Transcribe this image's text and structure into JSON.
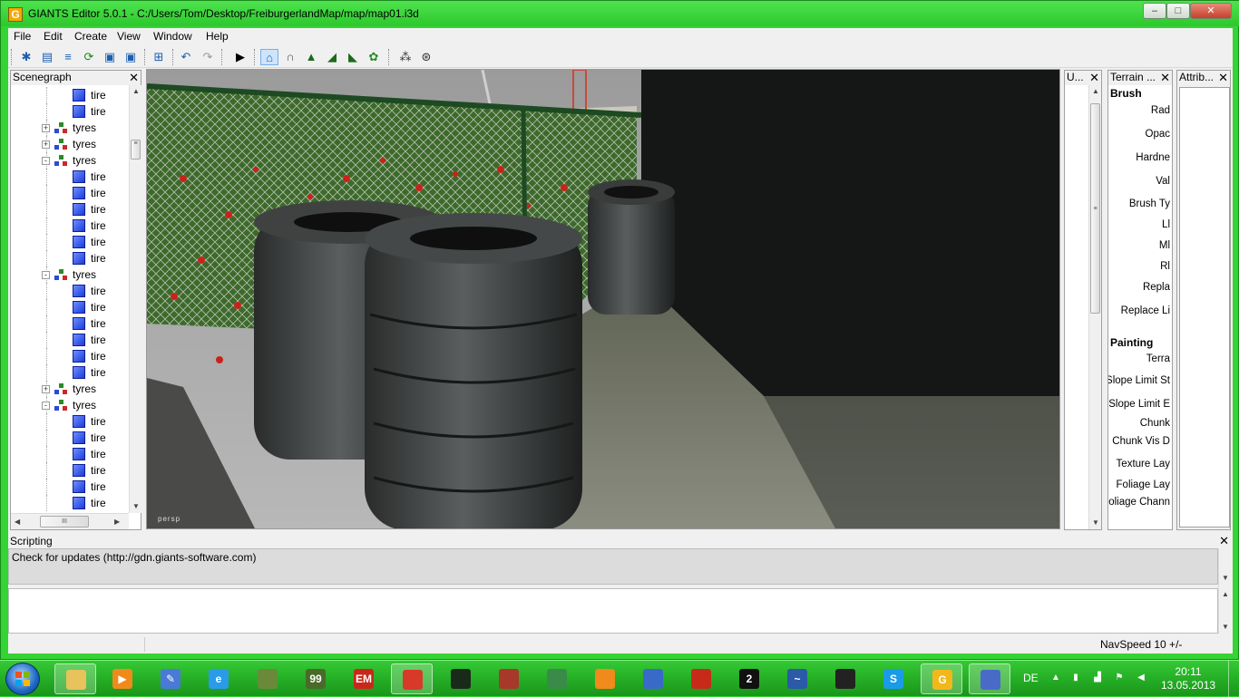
{
  "window": {
    "title": "GIANTS Editor 5.0.1 - C:/Users/Tom/Desktop/FreiburgerlandMap/map/map01.i3d",
    "app_icon_glyph": "G",
    "min_glyph": "–",
    "max_glyph": "□",
    "close_glyph": "✕"
  },
  "menu": {
    "file": "File",
    "edit": "Edit",
    "create": "Create",
    "view": "View",
    "window": "Window",
    "help": "Help"
  },
  "toolbar": {
    "icons": [
      "new-scene-icon",
      "open-icon",
      "recent-icon",
      "reload-icon",
      "save-icon",
      "save-as-icon",
      "import-icon",
      "undo-icon",
      "redo-icon",
      "play-icon",
      "select-home-icon",
      "magnet-icon",
      "terrain-sculpt-icon",
      "terrain-paint-icon",
      "terrain-foliage-icon",
      "foliage-paint-icon",
      "particle-icon",
      "particle-emitter-icon"
    ]
  },
  "scenegraph": {
    "title": "Scenegraph",
    "close": "✕",
    "rows": [
      {
        "label": "tire",
        "type": "shape",
        "level": 2,
        "expander": ""
      },
      {
        "label": "tire",
        "type": "shape",
        "level": 2,
        "expander": ""
      },
      {
        "label": "tyres",
        "type": "group",
        "level": 1,
        "expander": "+"
      },
      {
        "label": "tyres",
        "type": "group",
        "level": 1,
        "expander": "+"
      },
      {
        "label": "tyres",
        "type": "group",
        "level": 1,
        "expander": "-"
      },
      {
        "label": "tire",
        "type": "shape",
        "level": 2,
        "expander": ""
      },
      {
        "label": "tire",
        "type": "shape",
        "level": 2,
        "expander": ""
      },
      {
        "label": "tire",
        "type": "shape",
        "level": 2,
        "expander": ""
      },
      {
        "label": "tire",
        "type": "shape",
        "level": 2,
        "expander": ""
      },
      {
        "label": "tire",
        "type": "shape",
        "level": 2,
        "expander": ""
      },
      {
        "label": "tire",
        "type": "shape",
        "level": 2,
        "expander": ""
      },
      {
        "label": "tyres",
        "type": "group",
        "level": 1,
        "expander": "-"
      },
      {
        "label": "tire",
        "type": "shape",
        "level": 2,
        "expander": ""
      },
      {
        "label": "tire",
        "type": "shape",
        "level": 2,
        "expander": ""
      },
      {
        "label": "tire",
        "type": "shape",
        "level": 2,
        "expander": ""
      },
      {
        "label": "tire",
        "type": "shape",
        "level": 2,
        "expander": ""
      },
      {
        "label": "tire",
        "type": "shape",
        "level": 2,
        "expander": ""
      },
      {
        "label": "tire",
        "type": "shape",
        "level": 2,
        "expander": ""
      },
      {
        "label": "tyres",
        "type": "group",
        "level": 1,
        "expander": "+"
      },
      {
        "label": "tyres",
        "type": "group",
        "level": 1,
        "expander": "-"
      },
      {
        "label": "tire",
        "type": "shape",
        "level": 2,
        "expander": ""
      },
      {
        "label": "tire",
        "type": "shape",
        "level": 2,
        "expander": ""
      },
      {
        "label": "tire",
        "type": "shape",
        "level": 2,
        "expander": ""
      },
      {
        "label": "tire",
        "type": "shape",
        "level": 2,
        "expander": ""
      },
      {
        "label": "tire",
        "type": "shape",
        "level": 2,
        "expander": ""
      },
      {
        "label": "tire",
        "type": "shape",
        "level": 2,
        "expander": ""
      }
    ],
    "hscroll_thumb": "III"
  },
  "viewport": {
    "camera_label": "persp"
  },
  "u_panel": {
    "title": "U...",
    "close": "✕",
    "thumb": "≡"
  },
  "terrain_panel": {
    "title": "Terrain ...",
    "close": "✕",
    "brush_section": "Brush",
    "brush_fields": [
      "Rad",
      "Opac",
      "Hardne",
      "Val",
      "Brush Ty",
      "Ll",
      "Ml",
      "Rl",
      "Repla",
      "Replace Li"
    ],
    "painting_section": "Painting",
    "painting_fields": [
      "Terra",
      "Slope Limit St",
      "Slope Limit E",
      "Chunk",
      "Chunk Vis D",
      "Texture Lay",
      "Foliage Lay",
      "Foliage Chann"
    ]
  },
  "attrib_panel": {
    "title": "Attrib...",
    "close": "✕"
  },
  "scripting": {
    "title": "Scripting",
    "close": "✕",
    "log_line": "Check for updates (http://gdn.giants-software.com)"
  },
  "status": {
    "navspeed": "NavSpeed 10 +/-"
  },
  "taskbar": {
    "items": [
      {
        "name": "explorer-task",
        "color": "#e8c25a",
        "glyph": ""
      },
      {
        "name": "media-player-task",
        "color": "#f08a1a",
        "glyph": "▶"
      },
      {
        "name": "pen-tool-task",
        "color": "#4a7ad8",
        "glyph": "✎"
      },
      {
        "name": "internet-explorer-task",
        "color": "#2a9be8",
        "glyph": "e"
      },
      {
        "name": "minecraft-task",
        "color": "#6a8a3a",
        "glyph": ""
      },
      {
        "name": "farming-simulator-task",
        "color": "#4a6a2a",
        "glyph": "99"
      },
      {
        "name": "em2012-game-task",
        "color": "#c8281a",
        "glyph": "EM"
      },
      {
        "name": "chrome-task",
        "color": "#d83a2a",
        "glyph": ""
      },
      {
        "name": "tractor-task",
        "color": "#1a2a1a",
        "glyph": ""
      },
      {
        "name": "farm-game-task",
        "color": "#a8382a",
        "glyph": ""
      },
      {
        "name": "seahorse-app-task",
        "color": "#3a8a4a",
        "glyph": ""
      },
      {
        "name": "blender-task",
        "color": "#f08a1a",
        "glyph": ""
      },
      {
        "name": "train-game-task",
        "color": "#3a6ac8",
        "glyph": ""
      },
      {
        "name": "red-tractor-task",
        "color": "#c82a1a",
        "glyph": ""
      },
      {
        "name": "second-app-task",
        "color": "#111111",
        "glyph": "2"
      },
      {
        "name": "messenger-task",
        "color": "#2a5aa8",
        "glyph": "~"
      },
      {
        "name": "feather-app-task",
        "color": "#222222",
        "glyph": ""
      },
      {
        "name": "skype-task",
        "color": "#1a9be8",
        "glyph": "S"
      },
      {
        "name": "giants-editor-task",
        "color": "#f2b81a",
        "glyph": "G"
      },
      {
        "name": "image-editor-task",
        "color": "#4a6ac8",
        "glyph": ""
      }
    ],
    "language": "DE",
    "time": "20:11",
    "date": "13.05.2013"
  }
}
